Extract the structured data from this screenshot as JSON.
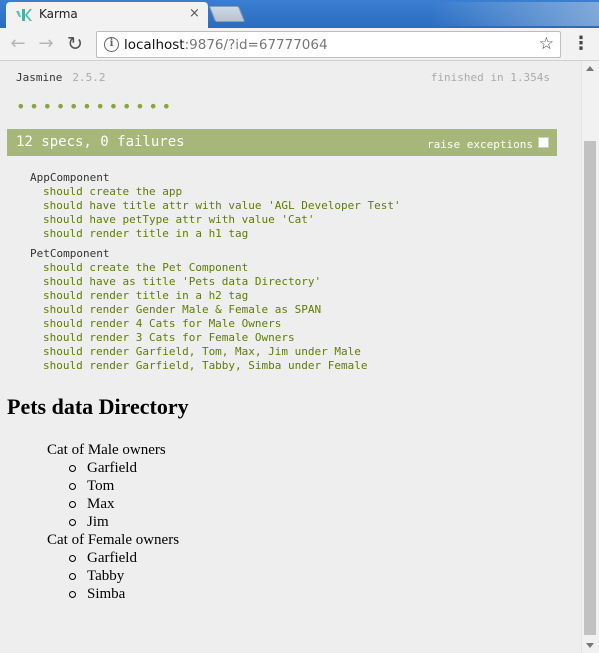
{
  "browser": {
    "tab_title": "Karma",
    "tab_close": "×",
    "url_host": "localhost",
    "url_rest": ":9876/?id=67777064",
    "nav": {
      "back": "←",
      "forward": "→",
      "reload": "↻"
    },
    "info": "i",
    "star": "☆",
    "menu": "⋮",
    "icons": [
      "karma-logo-icon",
      "close-icon",
      "back-arrow-icon",
      "forward-arrow-icon",
      "reload-icon",
      "info-icon",
      "star-icon",
      "menu-icon"
    ],
    "accent_color": "#2a6cc0"
  },
  "jasmine": {
    "title": "Jasmine",
    "version": "2.5.2",
    "finished": "finished in 1.354s",
    "dots": "••••••••••••",
    "summary": "12 specs, 0 failures",
    "raise_label": "raise exceptions",
    "bar_color": "#a6b779",
    "pass_color": "#5e7d00"
  },
  "suites": [
    {
      "name": "AppComponent",
      "specs": [
        "should create the app",
        "should have title attr with value 'AGL Developer Test'",
        "should have petType attr with value 'Cat'",
        "should render title in a h1 tag"
      ]
    },
    {
      "name": "PetComponent",
      "specs": [
        "should create the Pet Component",
        "should have as title 'Pets data Directory'",
        "should render title in a h2 tag",
        "should render Gender Male & Female as SPAN",
        "should render 4 Cats for Male Owners",
        "should render 3 Cats for Female Owners",
        "should render Garfield, Tom, Max, Jim under Male",
        "should render Garfield, Tabby, Simba under Female"
      ]
    }
  ],
  "app": {
    "title": "Pets data Directory",
    "male_label": "Cat of Male owners",
    "male_cats": [
      "Garfield",
      "Tom",
      "Max",
      "Jim"
    ],
    "female_label": "Cat of Female owners",
    "female_cats": [
      "Garfield",
      "Tabby",
      "Simba"
    ]
  }
}
